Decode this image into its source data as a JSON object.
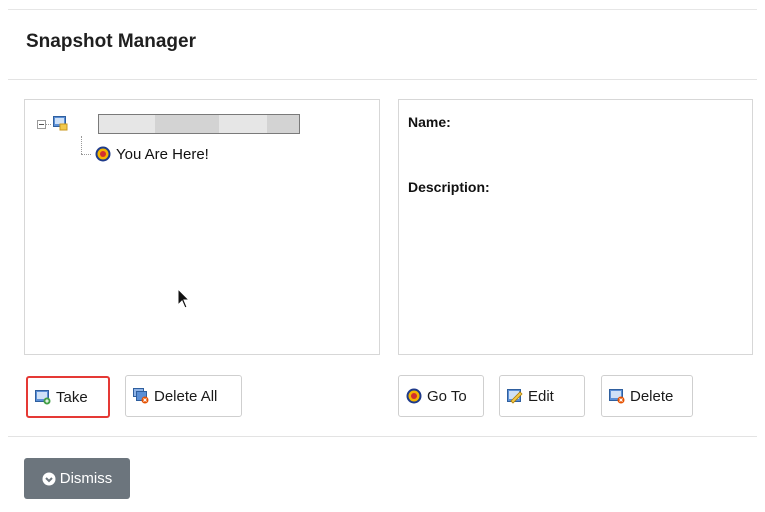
{
  "dialog": {
    "title": "Snapshot Manager"
  },
  "tree": {
    "root_label": "",
    "current_node_label": "You Are Here!"
  },
  "details": {
    "name_label": "Name:",
    "description_label": "Description:"
  },
  "buttons": {
    "take": "Take",
    "delete_all": "Delete All",
    "go_to": "Go To",
    "edit": "Edit",
    "delete": "Delete",
    "dismiss": "Dismiss"
  },
  "colors": {
    "highlight_border": "#e53935",
    "dismiss_bg": "#6c757d"
  }
}
